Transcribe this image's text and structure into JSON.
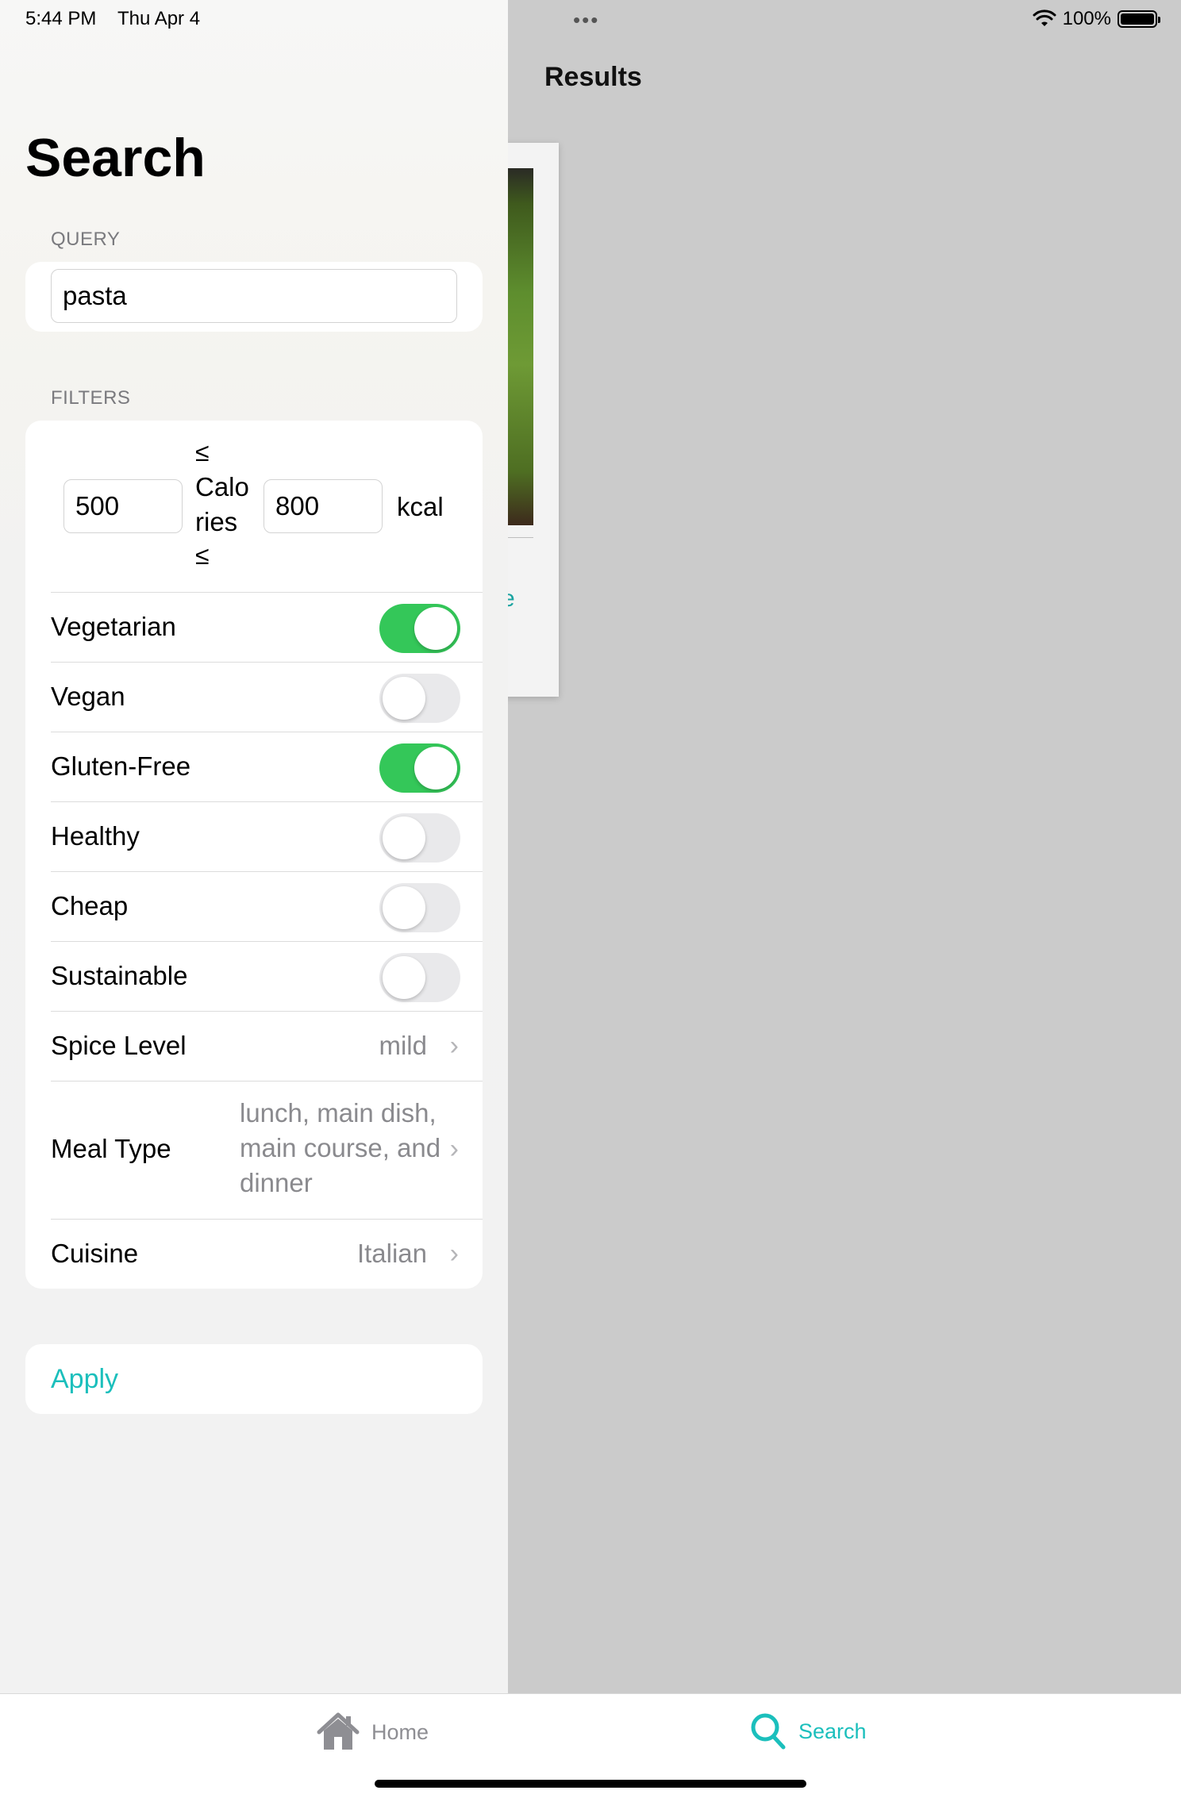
{
  "status_bar": {
    "time": "5:44 PM",
    "date": "Thu Apr 4",
    "dots": "•••",
    "battery": "100%"
  },
  "results": {
    "title": "Results",
    "link_fragment": "e"
  },
  "search": {
    "title": "Search",
    "query_label": "QUERY",
    "query_value": "pasta",
    "filters_label": "FILTERS",
    "calories": {
      "leq_top": "≤",
      "label": "Calo ries",
      "leq_bottom": "≤",
      "min": "500",
      "max": "800",
      "unit": "kcal"
    },
    "toggles": [
      {
        "label": "Vegetarian",
        "on": true
      },
      {
        "label": "Vegan",
        "on": false
      },
      {
        "label": "Gluten-Free",
        "on": true
      },
      {
        "label": "Healthy",
        "on": false
      },
      {
        "label": "Cheap",
        "on": false
      },
      {
        "label": "Sustainable",
        "on": false
      }
    ],
    "spice_level": {
      "label": "Spice Level",
      "value": "mild"
    },
    "meal_type": {
      "label": "Meal Type",
      "value": "lunch, main dish, main course, and dinner"
    },
    "cuisine": {
      "label": "Cuisine",
      "value": "Italian"
    },
    "apply_label": "Apply"
  },
  "tab_bar": {
    "home_label": "Home",
    "search_label": "Search"
  },
  "colors": {
    "accent": "#1bbfbc",
    "toggle_on": "#34c759",
    "toggle_off": "#e9e9eb"
  }
}
